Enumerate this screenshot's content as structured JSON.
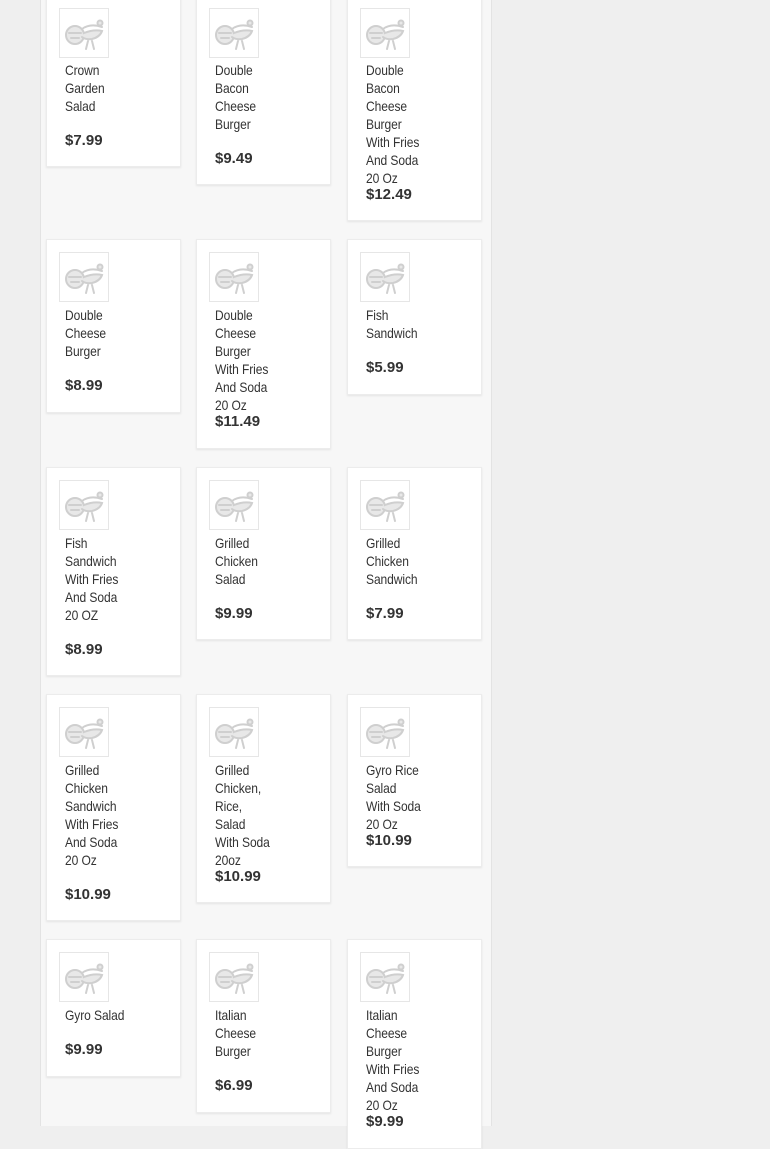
{
  "menu_items": [
    {
      "name": "Crown Garden Salad",
      "price": "$7.99"
    },
    {
      "name": "Double Bacon Cheese Burger",
      "price": "$9.49"
    },
    {
      "name": "Double Bacon Cheese Burger With Fries And Soda 20 Oz",
      "price": "$12.49"
    },
    {
      "name": "Double Cheese Burger",
      "price": "$8.99"
    },
    {
      "name": "Double Cheese Burger With Fries And Soda 20 Oz",
      "price": "$11.49"
    },
    {
      "name": "Fish Sandwich",
      "price": "$5.99"
    },
    {
      "name": "Fish Sandwich With Fries And Soda 20 OZ",
      "price": "$8.99"
    },
    {
      "name": "Grilled Chicken Salad",
      "price": "$9.99"
    },
    {
      "name": "Grilled Chicken Sandwich",
      "price": "$7.99"
    },
    {
      "name": "Grilled Chicken Sandwich With Fries And Soda 20 Oz",
      "price": "$10.99"
    },
    {
      "name": "Grilled Chicken, Rice, Salad With Soda 20oz",
      "price": "$10.99"
    },
    {
      "name": "Gyro Rice Salad With Soda 20 Oz",
      "price": "$10.99"
    },
    {
      "name": "Gyro Salad",
      "price": "$9.99"
    },
    {
      "name": "Italian Cheese Burger",
      "price": "$6.99"
    },
    {
      "name": "Italian Cheese Burger With Fries And Soda 20 Oz",
      "price": "$9.99"
    }
  ],
  "placeholder_icon": "food-placeholder-icon",
  "colors": {
    "text": "#333333",
    "page_bg": "#efefef",
    "card_bg": "#ffffff"
  }
}
